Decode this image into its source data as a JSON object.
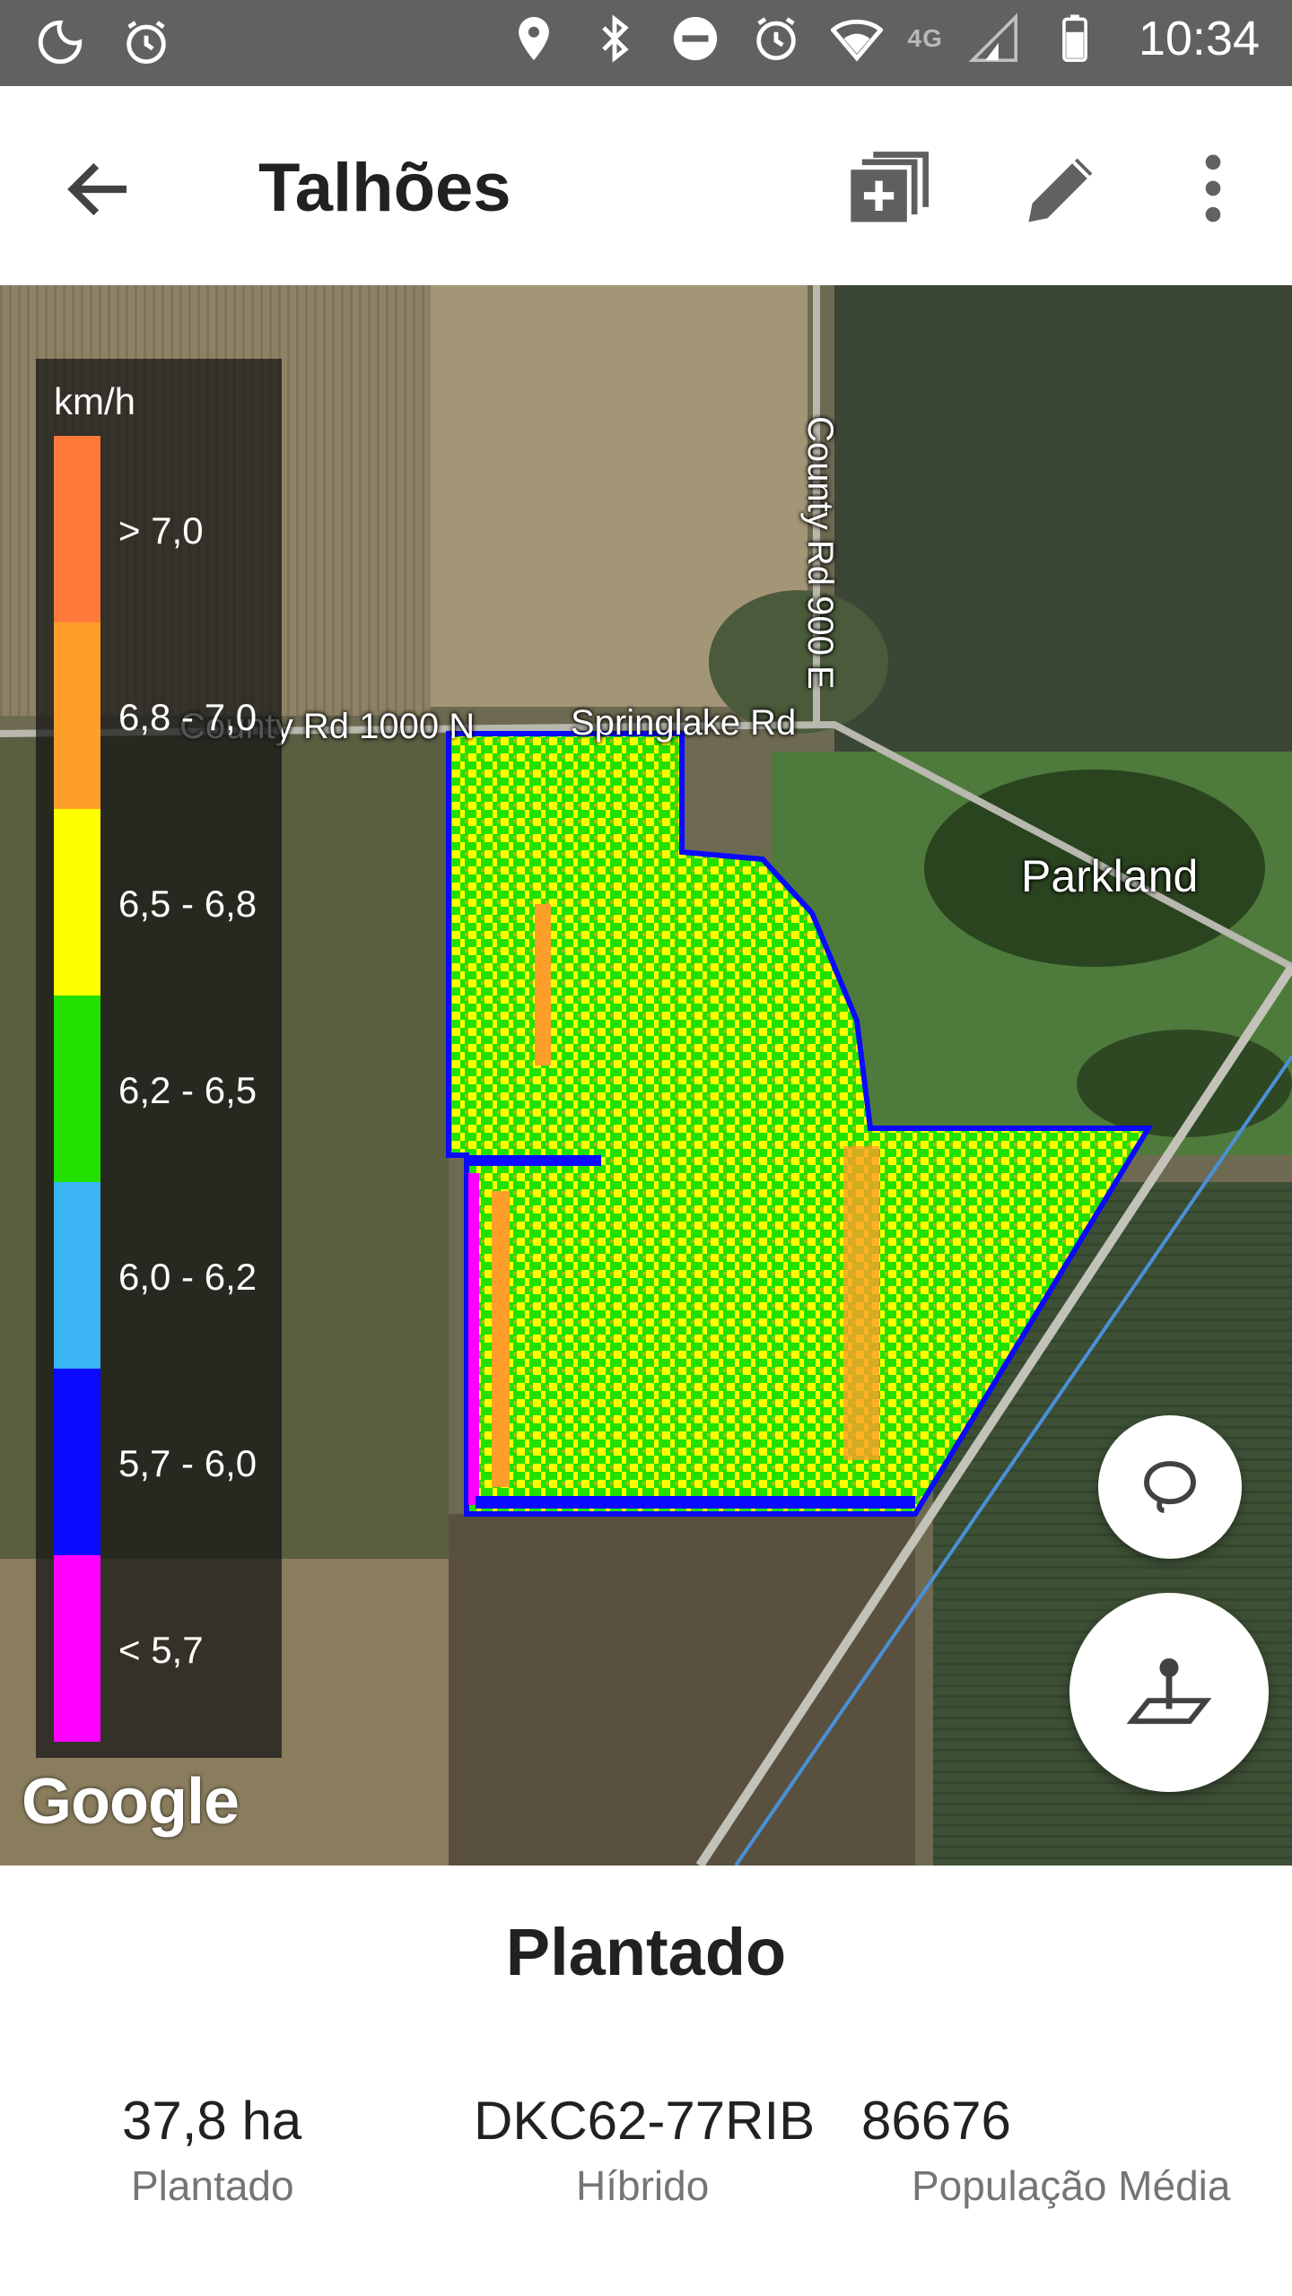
{
  "status_bar": {
    "time": "10:34",
    "network_label": "4G",
    "icons_left": [
      "moon-icon",
      "alarm-icon"
    ],
    "icons_right": [
      "location-icon",
      "bluetooth-icon",
      "do-not-disturb-icon",
      "alarm-icon",
      "wifi-icon",
      "signal-icon",
      "battery-icon"
    ]
  },
  "app_bar": {
    "title": "Talhões",
    "actions": [
      "back-arrow-icon",
      "layers-add-icon",
      "edit-pencil-icon",
      "more-vert-icon"
    ]
  },
  "map": {
    "roads": {
      "county_rd_1000n": "County Rd 1000 N",
      "springlake_rd": "Springlake Rd",
      "county_rd_900e": "County Rd 900 E"
    },
    "place": "Parkland",
    "attribution": "Google",
    "legend": {
      "unit": "km/h",
      "items": [
        {
          "label": "> 7,0",
          "color": "#ff7a3a"
        },
        {
          "label": "6,8 - 7,0",
          "color": "#ff9f2a"
        },
        {
          "label": "6,5 - 6,8",
          "color": "#ffff00"
        },
        {
          "label": "6,2 - 6,5",
          "color": "#22e000"
        },
        {
          "label": "6,0 - 6,2",
          "color": "#3ab4f2"
        },
        {
          "label": "5,7 - 6,0",
          "color": "#0a0aff"
        },
        {
          "label": "< 5,7",
          "color": "#ff00ff"
        }
      ]
    },
    "buttons": [
      "lasso-icon",
      "field-pin-icon"
    ]
  },
  "summary": {
    "title": "Plantado",
    "stats": [
      {
        "value": "37,8 ha",
        "label": "Plantado"
      },
      {
        "value": "DKC62-77RIB",
        "label": "Híbrido"
      },
      {
        "value": "86676",
        "label": "População Média"
      }
    ]
  }
}
